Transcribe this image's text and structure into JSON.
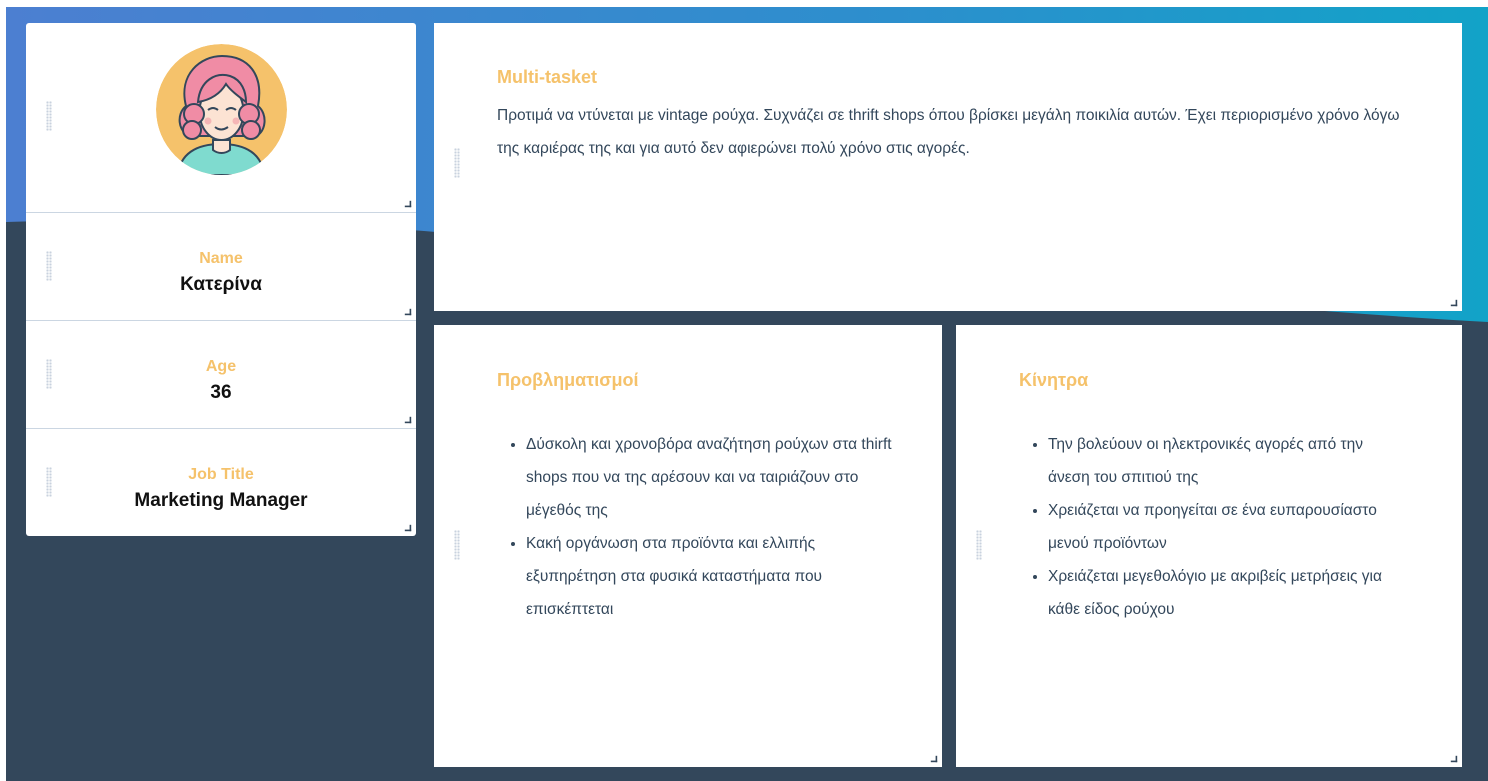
{
  "profile": {
    "avatar_icon": "woman-avatar-icon",
    "name_label": "Name",
    "name_value": "Κατερίνα",
    "age_label": "Age",
    "age_value": "36",
    "job_label": "Job Title",
    "job_value": "Marketing Manager"
  },
  "multitask": {
    "title": "Multi-tasket",
    "text": "Προτιμά να ντύνεται με vintage ρούχα. Συχνάζει σε thrift shops όπου βρίσκει μεγάλη ποικιλία αυτών. Έχει περιορισμένο χρόνο λόγω της καριέρας της και για αυτό δεν αφιερώνει πολύ χρόνο στις αγορές."
  },
  "concerns": {
    "title": "Προβληματισμοί",
    "items": [
      "Δύσκολη και χρονοβόρα αναζήτηση ρούχων στα thirft shops που να της αρέσουν και να ταιριάζουν στο μέγεθός της",
      "Κακή οργάνωση στα προϊόντα και ελλιπής εξυπηρέτηση στα φυσικά καταστήματα που επισκέπτεται"
    ]
  },
  "motivations": {
    "title": "Κίνητρα",
    "items": [
      "Την βολεύουν οι ηλεκτρονικές αγορές από την άνεση του σπιτιού της",
      "Χρειάζεται να προηγείται σε ένα ευπαρουσίαστο μενού προϊόντων",
      "Χρειάζεται μεγεθολόγιο με ακριβείς μετρήσεις για κάθε είδος ρούχου"
    ]
  },
  "colors": {
    "accent": "#f5c26b",
    "background_dark": "#33475b",
    "gradient_start": "#4a7fd0",
    "gradient_end": "#12a3c8",
    "text": "#33475b"
  }
}
